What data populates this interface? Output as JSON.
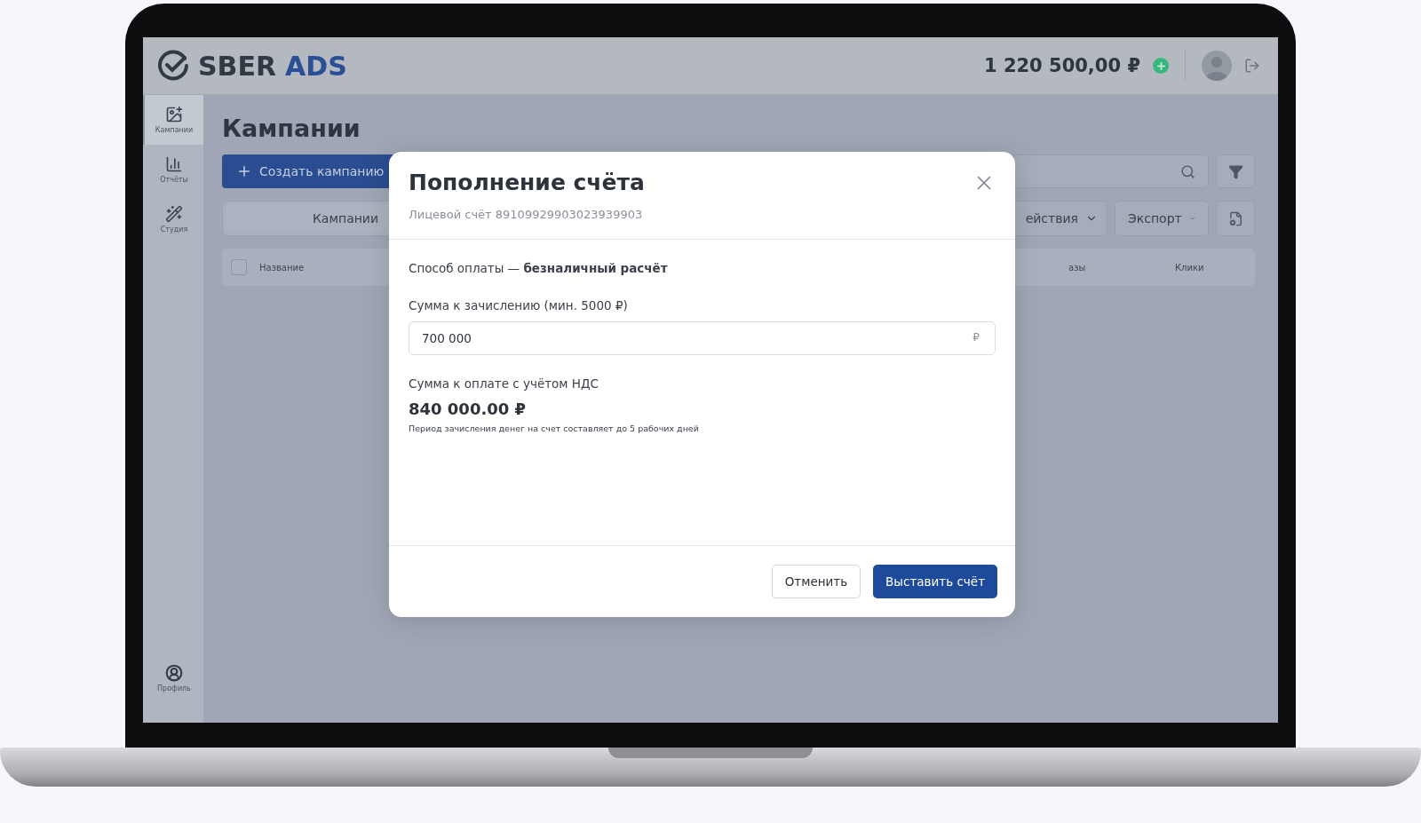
{
  "header": {
    "logo": {
      "part_1": "SBER",
      "part_2": "ADS"
    },
    "balance": "1 220 500,00 ₽"
  },
  "sidebar": {
    "items": [
      {
        "label": "Кампании",
        "selected": true,
        "kind": "campaigns"
      },
      {
        "label": "Отчёты",
        "selected": false,
        "kind": "reports"
      },
      {
        "label": "Студия",
        "selected": false,
        "kind": "studio"
      }
    ],
    "profile": "Профиль"
  },
  "page": {
    "title": "Кампании",
    "create_button": "Создать кампанию",
    "tab": "Кампании",
    "actions_dropdown": "ействия",
    "export_dropdown": "Экспорт",
    "table": {
      "select_all_checked": false,
      "columns": [
        "Название",
        "азы",
        "Клики"
      ]
    }
  },
  "modal": {
    "title": "Пополнение счёта",
    "account": "Лицевой счёт 89109929903023939903",
    "payment": "Способ оплаты — **безналичный расчёт**",
    "amount_label": "Сумма к зачислению (мин. 5000 ₽)",
    "amount_value": "700 000",
    "currency": "₽",
    "total_label": "Сумма к оплате с учётом НДС",
    "total": "840 000.00 ₽",
    "note": "Период зачисления денег на счет составляет до 5 рабочих дней",
    "cancel_button": "Отменить",
    "submit_button": "Выставить счёт"
  }
}
